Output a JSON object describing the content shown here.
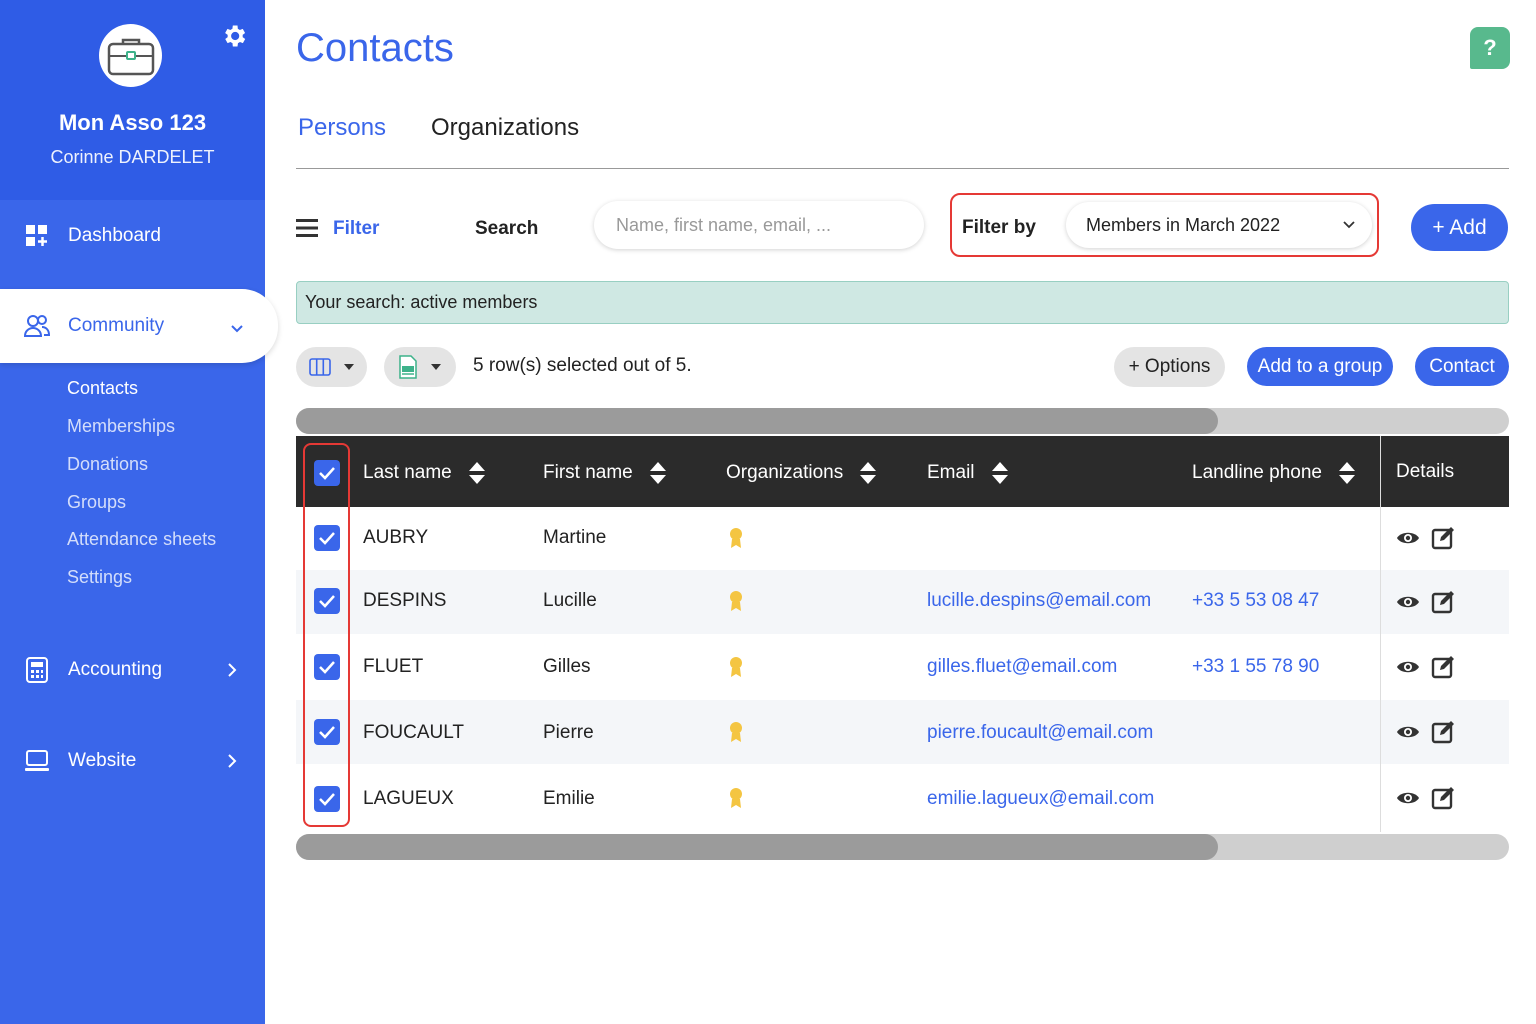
{
  "sidebar": {
    "org_name": "Mon Asso 123",
    "user_name": "Corinne DARDELET",
    "nav": {
      "dashboard": "Dashboard",
      "community": "Community",
      "accounting": "Accounting",
      "website": "Website"
    },
    "community_sub": [
      "Contacts",
      "Memberships",
      "Donations",
      "Groups",
      "Attendance sheets",
      "Settings"
    ]
  },
  "header": {
    "title": "Contacts",
    "help": "?"
  },
  "tabs": [
    "Persons",
    "Organizations"
  ],
  "toolbar": {
    "filter_label": "Filter",
    "search_label": "Search",
    "search_placeholder": "Name, first name, email, ...",
    "filter_by_label": "Filter by",
    "filter_by_value": "Members in March 2022",
    "add_label": "+ Add"
  },
  "search_banner": "Your search: active members",
  "actions": {
    "rows_selected": "5 row(s) selected out of 5.",
    "options": "+ Options",
    "add_to_group": "Add to a group",
    "contact": "Contact"
  },
  "scrollbar": {
    "thumb_fraction": 0.76
  },
  "table": {
    "columns": [
      "Last name",
      "First name",
      "Organizations",
      "Email",
      "Landline phone",
      "Details"
    ],
    "rows": [
      {
        "last": "AUBRY",
        "first": "Martine",
        "email": "",
        "phone": "",
        "checked": true
      },
      {
        "last": "DESPINS",
        "first": "Lucille",
        "email": "lucille.despins@email.com",
        "phone": "+33 5 53 08 47",
        "checked": true
      },
      {
        "last": "FLUET",
        "first": "Gilles",
        "email": "gilles.fluet@email.com",
        "phone": "+33 1 55 78 90",
        "checked": true
      },
      {
        "last": "FOUCAULT",
        "first": "Pierre",
        "email": "pierre.foucault@email.com",
        "phone": "",
        "checked": true
      },
      {
        "last": "LAGUEUX",
        "first": "Emilie",
        "email": "emilie.lagueux@email.com",
        "phone": "",
        "checked": true
      }
    ]
  },
  "colors": {
    "accent": "#3a66ea",
    "sidebar": "#3a66ea",
    "highlight": "#e53935",
    "banner": "#cfe8e3",
    "help": "#58b98d"
  },
  "icons": [
    "briefcase-icon",
    "gear-icon",
    "dashboard-icon",
    "community-icon",
    "accounting-icon",
    "website-icon",
    "menu-icon",
    "columns-icon",
    "xls-icon",
    "sort-icon",
    "medal-icon",
    "eye-icon",
    "edit-icon",
    "check-icon"
  ]
}
